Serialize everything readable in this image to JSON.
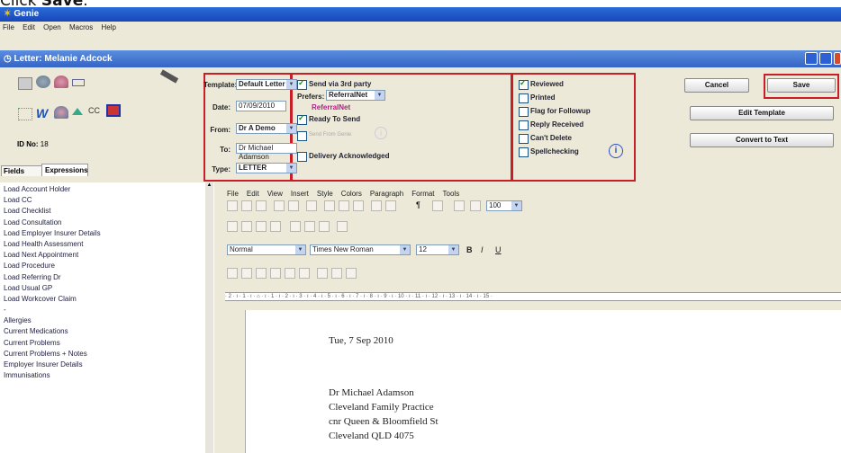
{
  "instruction": {
    "prefix": "Click ",
    "action": "Save",
    "suffix": "."
  },
  "app": {
    "title": "Genie"
  },
  "menu": [
    "File",
    "Edit",
    "Open",
    "Macros",
    "Help"
  ],
  "window": {
    "title": "Letter: Melanie Adcock"
  },
  "id_no": {
    "label": "ID No:",
    "value": "18"
  },
  "tabs": [
    "Fields",
    "Expressions"
  ],
  "form": {
    "template_label": "Template:",
    "template_value": "Default Letter",
    "date_label": "Date:",
    "date_value": "07/09/2010",
    "from_label": "From:",
    "from_value": "Dr A Demo",
    "to_label": "To:",
    "to_value": "Dr Michael Adamson",
    "type_label": "Type:",
    "type_value": "LETTER"
  },
  "send": {
    "send_3rd_party": "Send via 3rd party",
    "prefers_label": "Prefers:",
    "prefers_value": "ReferralNet",
    "referralnet": "ReferralNet",
    "ready_to_send": "Ready To Send",
    "send_from_genie": "Send From Genie",
    "delivery_ack": "Delivery Acknowledged"
  },
  "status": {
    "reviewed": "Reviewed",
    "printed": "Printed",
    "flag_followup": "Flag for Followup",
    "reply_received": "Reply Received",
    "cant_delete": "Can't Delete",
    "spellchecking": "Spellchecking"
  },
  "buttons": {
    "cancel": "Cancel",
    "save": "Save",
    "edit_template": "Edit Template",
    "convert_text": "Convert to Text"
  },
  "left_list": [
    "Load Account Holder",
    "Load CC",
    "Load Checklist",
    "Load Consultation",
    "Load Employer Insurer Details",
    "Load Health Assessment",
    "Load Next Appointment",
    "Load Procedure",
    "Load Referring Dr",
    "Load Usual GP",
    "Load Workcover Claim",
    "-",
    "Allergies",
    "Current Medications",
    "Current Problems",
    "Current Problems + Notes",
    "Employer Insurer Details",
    "Immunisations"
  ],
  "editor_menu": [
    "File",
    "Edit",
    "View",
    "Insert",
    "Style",
    "Colors",
    "Paragraph",
    "Format",
    "Tools"
  ],
  "zoom": "100",
  "style_value": "Normal",
  "font_value": "Times New Roman",
  "size_value": "12",
  "ruler_text": "· 2 · ı · 1 · ı · ⌂ · ı · 1 · ı · 2 · ı · 3 · ı · 4 · ı · 5 · ı · 6 · ı · 7 · ı · 8 · ı · 9 · ı · 10 · ı · 11 · ı · 12 · ı · 13 · ı · 14 · ı · 15 ·",
  "document": {
    "date_line": "Tue, 7 Sep 2010",
    "address": [
      "Dr Michael Adamson",
      "Cleveland Family Practice",
      "cnr Queen & Bloomfield St",
      "Cleveland QLD 4075"
    ]
  },
  "colors": {
    "highlight": "#c81e28",
    "titlebar": "#2a6cd8",
    "chrome": "#ece9d8"
  }
}
